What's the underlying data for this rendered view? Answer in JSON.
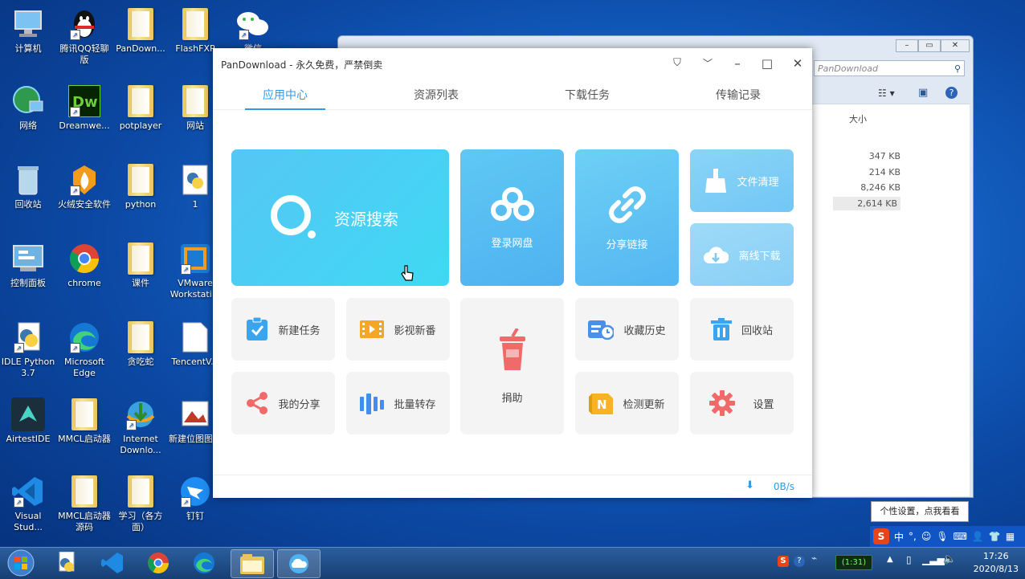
{
  "desktop": {
    "icons": [
      {
        "label": "计算机"
      },
      {
        "label": "腾讯QQ轻聊版"
      },
      {
        "label": "PanDown..."
      },
      {
        "label": "FlashFXP"
      },
      {
        "label": "微信"
      },
      {
        "label": "网络"
      },
      {
        "label": "Dreamwe..."
      },
      {
        "label": "potplayer"
      },
      {
        "label": "网站"
      },
      {
        "label": "回收站"
      },
      {
        "label": "火绒安全软件"
      },
      {
        "label": "python"
      },
      {
        "label": "1"
      },
      {
        "label": "控制面板"
      },
      {
        "label": "chrome"
      },
      {
        "label": "课件"
      },
      {
        "label": "VMware Workstati..."
      },
      {
        "label": "IDLE Python 3.7"
      },
      {
        "label": "Microsoft Edge"
      },
      {
        "label": "贪吃蛇"
      },
      {
        "label": "TencentV..."
      },
      {
        "label": "AirtestIDE"
      },
      {
        "label": "MMCL启动器"
      },
      {
        "label": "Internet Downlo..."
      },
      {
        "label": "新建位图图像"
      },
      {
        "label": "Visual Stud..."
      },
      {
        "label": "MMCL启动器源码"
      },
      {
        "label": "学习（各方面）"
      },
      {
        "label": "钉钉"
      }
    ]
  },
  "explorer": {
    "search_placeholder": "PanDownload",
    "size_header": "大小",
    "file_sizes": [
      "347 KB",
      "214 KB",
      "8,246 KB",
      "2,614 KB"
    ]
  },
  "pan": {
    "title": "PanDownload - 永久免费，严禁倒卖",
    "tabs": [
      "应用中心",
      "资源列表",
      "下载任务",
      "传输记录"
    ],
    "tiles": {
      "search": "资源搜索",
      "login": "登录网盘",
      "share_link": "分享链接",
      "cleanup": "文件清理",
      "offline": "离线下载",
      "new_task": "新建任务",
      "video": "影视新番",
      "donate": "捐助",
      "history": "收藏历史",
      "recycle": "回收站",
      "my_share": "我的分享",
      "batch": "批量转存",
      "update": "检测更新",
      "settings": "设置"
    },
    "speed": "0B/s"
  },
  "tooltip": "个性设置，点我看看",
  "ime": {
    "lang": "中"
  },
  "taskbar": {
    "battery": "(1:31)",
    "time": "17:26",
    "date": "2020/8/13"
  }
}
